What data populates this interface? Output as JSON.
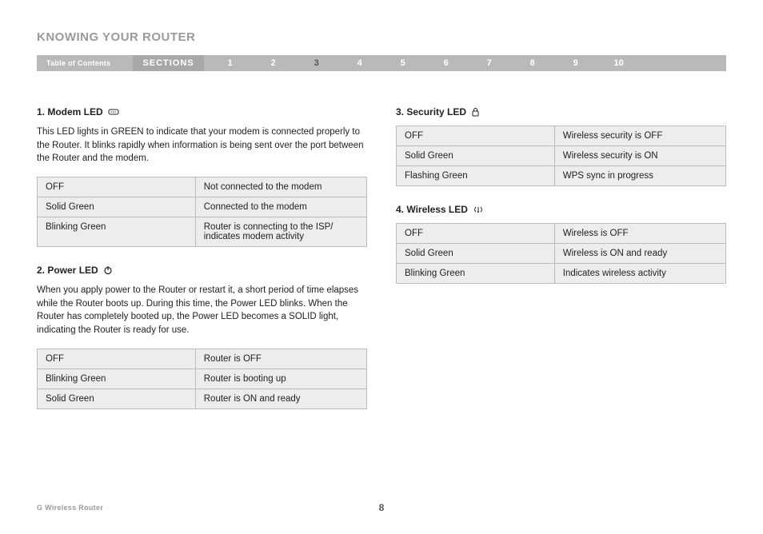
{
  "page_title": "KNOWING YOUR ROUTER",
  "nav": {
    "toc_label": "Table of Contents",
    "sections_label": "SECTIONS",
    "numbers": [
      "1",
      "2",
      "3",
      "4",
      "5",
      "6",
      "7",
      "8",
      "9",
      "10"
    ],
    "active": "3"
  },
  "left": {
    "sec1": {
      "heading": "1. Modem LED",
      "icon": "modem-icon",
      "text": "This LED lights in GREEN to indicate that your modem is connected properly to the Router. It blinks rapidly when information is being sent over the port between the Router and the modem.",
      "rows": [
        {
          "state": "OFF",
          "desc": "Not connected to the modem"
        },
        {
          "state": "Solid Green",
          "desc": "Connected to the modem"
        },
        {
          "state": "Blinking Green",
          "desc": "Router is connecting to the ISP/ indicates modem activity"
        }
      ]
    },
    "sec2": {
      "heading": "2. Power LED",
      "icon": "power-icon",
      "text": "When you apply power to the Router or restart it, a short period of time elapses while the Router boots up. During this time, the Power LED blinks. When the Router has completely booted up, the Power LED becomes a SOLID light, indicating the Router is ready for use.",
      "rows": [
        {
          "state": "OFF",
          "desc": "Router is OFF"
        },
        {
          "state": "Blinking Green",
          "desc": "Router is booting up"
        },
        {
          "state": "Solid Green",
          "desc": "Router is ON and ready"
        }
      ]
    }
  },
  "right": {
    "sec3": {
      "heading": "3. Security LED",
      "icon": "lock-icon",
      "rows": [
        {
          "state": "OFF",
          "desc": "Wireless security is OFF"
        },
        {
          "state": "Solid Green",
          "desc": "Wireless security is ON"
        },
        {
          "state": "Flashing Green",
          "desc": "WPS sync in progress"
        }
      ]
    },
    "sec4": {
      "heading": "4. Wireless LED",
      "icon": "wireless-icon",
      "rows": [
        {
          "state": "OFF",
          "desc": "Wireless is OFF"
        },
        {
          "state": "Solid Green",
          "desc": "Wireless is ON and ready"
        },
        {
          "state": "Blinking Green",
          "desc": "Indicates wireless activity"
        }
      ]
    }
  },
  "footer": {
    "product": "G Wireless Router",
    "page_number": "8"
  }
}
